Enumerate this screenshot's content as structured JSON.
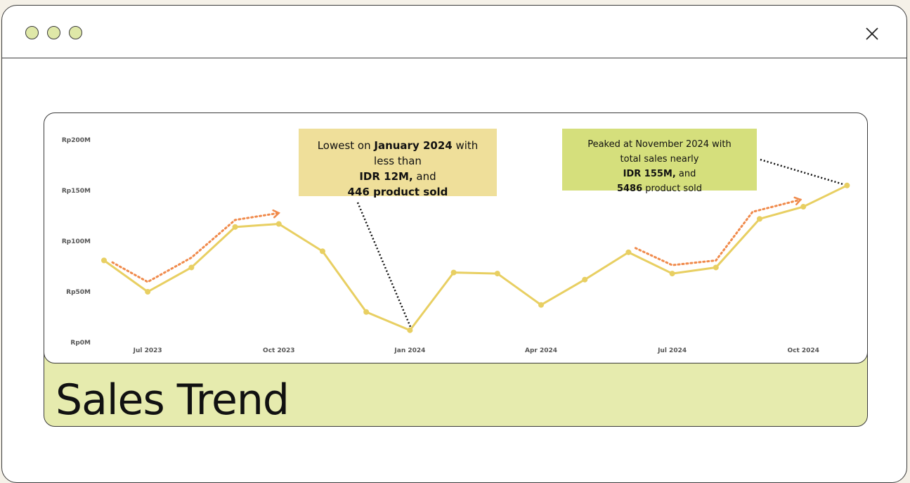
{
  "window": {
    "traffic_lights": [
      "circle",
      "circle",
      "circle"
    ],
    "close_icon": "close-icon"
  },
  "card": {
    "title": "Sales Trend",
    "menu_label": "•••"
  },
  "annotations": {
    "low": {
      "lines": [
        {
          "pre": "Lowest on ",
          "bold": "January 2024",
          "post": " with"
        },
        {
          "pre": "less than",
          "bold": "",
          "post": ""
        },
        {
          "pre": "",
          "bold": "IDR 12M,",
          "post": " and "
        },
        {
          "pre": "",
          "bold": "446 product sold",
          "post": ""
        }
      ]
    },
    "peak": {
      "lines": [
        {
          "pre": "Peaked at November 2024 with",
          "bold": "",
          "post": ""
        },
        {
          "pre": "total sales nearly",
          "bold": "",
          "post": ""
        },
        {
          "pre": "",
          "bold": "IDR 155M,",
          "post": " and "
        },
        {
          "pre": "",
          "bold": "5486",
          "post": " product sold"
        }
      ]
    }
  },
  "colors": {
    "line": "#e8cf62",
    "trend_arrow": "#f08a4b",
    "annot_low_bg": "#efdf9a",
    "annot_peak_bg": "#d5df7c",
    "footer_bg": "#e6ebae"
  },
  "chart_data": {
    "type": "line",
    "title": "Sales Trend",
    "y_ticks": [
      "Rp200M",
      "Rp150M",
      "Rp100M",
      "Rp50M",
      "Rp0M"
    ],
    "x_ticks": [
      "Jul 2023",
      "Oct 2023",
      "Jan 2024",
      "Apr 2024",
      "Jul 2024",
      "Oct 2024"
    ],
    "ylim": [
      0,
      200
    ],
    "x": [
      "Jun 2023",
      "Jul 2023",
      "Aug 2023",
      "Sep 2023",
      "Oct 2023",
      "Nov 2023",
      "Dec 2023",
      "Jan 2024",
      "Feb 2024",
      "Mar 2024",
      "Apr 2024",
      "May 2024",
      "Jun 2024",
      "Jul 2024",
      "Aug 2024",
      "Sep 2024",
      "Oct 2024",
      "Nov 2024"
    ],
    "values": [
      81,
      50,
      74,
      114,
      117,
      90,
      30,
      12,
      69,
      68,
      37,
      62,
      89,
      68,
      74,
      122,
      134,
      155
    ],
    "grid": false,
    "legend": "none"
  }
}
